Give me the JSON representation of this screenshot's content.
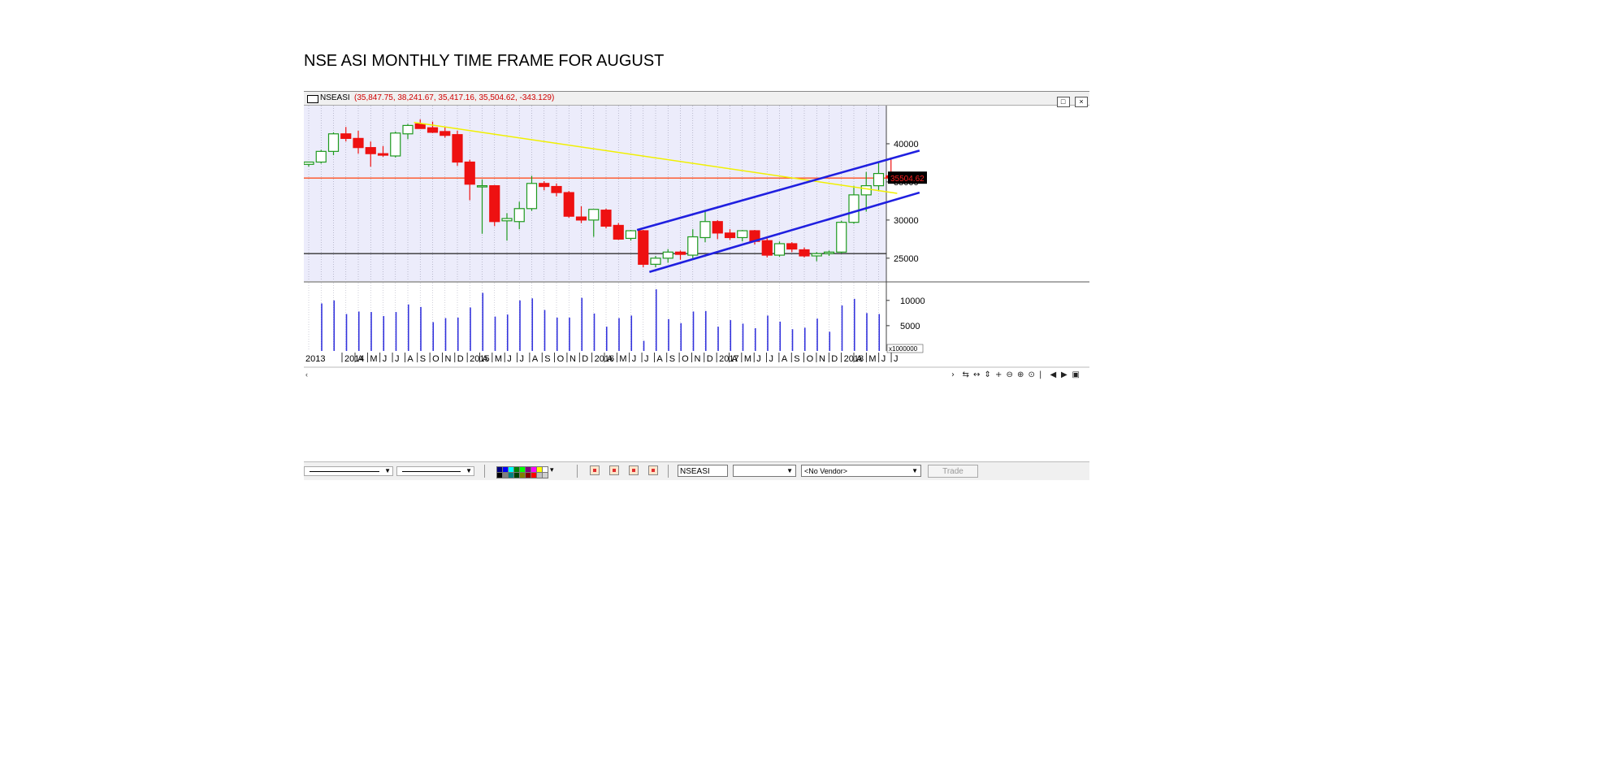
{
  "page": {
    "title": "NSE ASI MONTHLY TIME FRAME FOR AUGUST"
  },
  "window": {
    "symbol": "NSEASI",
    "ohlc": "(35,847.75, 38,241.67, 35,417.16, 35,504.62, -343.129)",
    "buttons": [
      "□",
      "×"
    ]
  },
  "toolbar": {
    "symbol_value": "NSEASI",
    "dropdown_empty": "",
    "vendor": "<No Vendor>",
    "trade_label": "Trade"
  },
  "colors": {
    "bull": "#1f9a1f",
    "bear": "#ee1111",
    "plot_bg": "#ececfb",
    "channel": "#1f1fe0",
    "trendline": "#f0f000",
    "resistance": "#ff5020",
    "support": "#333333",
    "volume": "#3333dd"
  },
  "chart_data": {
    "type": "candlestick",
    "price_ticks": [
      40000,
      35000,
      30000,
      25000
    ],
    "volume_ticks": [
      10000,
      5000
    ],
    "volume_scale_label": "x1000000",
    "last_price_label": "35504.62",
    "ylim": [
      22000,
      45000
    ],
    "volume_ylim": [
      0,
      13500
    ],
    "x_labels": [
      "2013",
      "2014",
      "A",
      "M",
      "J",
      "J",
      "A",
      "S",
      "O",
      "N",
      "D",
      "2015",
      "A",
      "M",
      "J",
      "J",
      "A",
      "S",
      "O",
      "N",
      "D",
      "2016",
      "A",
      "M",
      "J",
      "J",
      "A",
      "S",
      "O",
      "N",
      "D",
      "2017",
      "A",
      "M",
      "J",
      "J",
      "A",
      "S",
      "O",
      "N",
      "D",
      "2018",
      "A",
      "M",
      "J",
      "J"
    ],
    "candles": [
      {
        "o": 37300,
        "h": 37600,
        "l": 37000,
        "c": 37600
      },
      {
        "o": 37600,
        "h": 39200,
        "l": 37400,
        "c": 39000
      },
      {
        "o": 39000,
        "h": 41500,
        "l": 38500,
        "c": 41300
      },
      {
        "o": 41300,
        "h": 42200,
        "l": 40300,
        "c": 40700
      },
      {
        "o": 40700,
        "h": 41700,
        "l": 38700,
        "c": 39500
      },
      {
        "o": 39500,
        "h": 40300,
        "l": 37000,
        "c": 38700
      },
      {
        "o": 38700,
        "h": 39700,
        "l": 38300,
        "c": 38500
      },
      {
        "o": 38400,
        "h": 41600,
        "l": 38200,
        "c": 41400
      },
      {
        "o": 41300,
        "h": 42600,
        "l": 40600,
        "c": 42400
      },
      {
        "o": 42600,
        "h": 43200,
        "l": 42000,
        "c": 42000
      },
      {
        "o": 42100,
        "h": 42900,
        "l": 41400,
        "c": 41500
      },
      {
        "o": 41600,
        "h": 42200,
        "l": 40800,
        "c": 41100
      },
      {
        "o": 41200,
        "h": 41700,
        "l": 37100,
        "c": 37600
      },
      {
        "o": 37600,
        "h": 37900,
        "l": 32600,
        "c": 34700
      },
      {
        "o": 34500,
        "h": 35300,
        "l": 28200,
        "c": 34500
      },
      {
        "o": 34500,
        "h": 34600,
        "l": 29200,
        "c": 29800
      },
      {
        "o": 29900,
        "h": 30900,
        "l": 27300,
        "c": 30200
      },
      {
        "o": 29800,
        "h": 32400,
        "l": 28800,
        "c": 31500
      },
      {
        "o": 31500,
        "h": 35800,
        "l": 31200,
        "c": 34800
      },
      {
        "o": 34800,
        "h": 35100,
        "l": 33900,
        "c": 34400
      },
      {
        "o": 34400,
        "h": 34800,
        "l": 33100,
        "c": 33600
      },
      {
        "o": 33600,
        "h": 33800,
        "l": 30300,
        "c": 30500
      },
      {
        "o": 30400,
        "h": 31800,
        "l": 29600,
        "c": 30000
      },
      {
        "o": 30000,
        "h": 31400,
        "l": 27800,
        "c": 31400
      },
      {
        "o": 31300,
        "h": 31500,
        "l": 28900,
        "c": 29200
      },
      {
        "o": 29300,
        "h": 29600,
        "l": 27400,
        "c": 27500
      },
      {
        "o": 27600,
        "h": 28700,
        "l": 27300,
        "c": 28600
      },
      {
        "o": 28600,
        "h": 28700,
        "l": 23800,
        "c": 24200
      },
      {
        "o": 24200,
        "h": 25300,
        "l": 23800,
        "c": 25000
      },
      {
        "o": 25000,
        "h": 26200,
        "l": 24400,
        "c": 25800
      },
      {
        "o": 25800,
        "h": 26000,
        "l": 24800,
        "c": 25500
      },
      {
        "o": 25400,
        "h": 28800,
        "l": 25000,
        "c": 27800
      },
      {
        "o": 27700,
        "h": 31200,
        "l": 27100,
        "c": 29800
      },
      {
        "o": 29800,
        "h": 30000,
        "l": 27500,
        "c": 28300
      },
      {
        "o": 28300,
        "h": 28800,
        "l": 27400,
        "c": 27700
      },
      {
        "o": 27700,
        "h": 28700,
        "l": 27200,
        "c": 28600
      },
      {
        "o": 28600,
        "h": 28700,
        "l": 26800,
        "c": 27200
      },
      {
        "o": 27300,
        "h": 27600,
        "l": 25100,
        "c": 25400
      },
      {
        "o": 25400,
        "h": 27200,
        "l": 25200,
        "c": 26900
      },
      {
        "o": 26900,
        "h": 27100,
        "l": 25800,
        "c": 26200
      },
      {
        "o": 26100,
        "h": 26400,
        "l": 25100,
        "c": 25300
      },
      {
        "o": 25300,
        "h": 25800,
        "l": 24600,
        "c": 25600
      },
      {
        "o": 25600,
        "h": 26000,
        "l": 25300,
        "c": 25800
      },
      {
        "o": 25800,
        "h": 29900,
        "l": 25600,
        "c": 29700
      },
      {
        "o": 29700,
        "h": 34500,
        "l": 29500,
        "c": 33300
      },
      {
        "o": 33300,
        "h": 36300,
        "l": 31100,
        "c": 34500
      },
      {
        "o": 34500,
        "h": 37500,
        "l": 33800,
        "c": 36100
      },
      {
        "o": 35800,
        "h": 38200,
        "l": 35400,
        "c": 35500
      }
    ],
    "volumes": [
      9400,
      10000,
      7300,
      7800,
      7700,
      6900,
      7700,
      9200,
      8700,
      5700,
      6500,
      6600,
      8600,
      11500,
      6800,
      7200,
      10000,
      10400,
      8100,
      6600,
      6600,
      10500,
      7400,
      4800,
      6500,
      7000,
      2000,
      12200,
      6300,
      5500,
      7800,
      7900,
      4800,
      6100,
      5400,
      4500,
      7000,
      5800,
      4300,
      4600,
      6400,
      3800,
      9000,
      10300,
      7500,
      7300
    ],
    "lines": [
      {
        "name": "resistance",
        "y": 35504
      },
      {
        "name": "support",
        "y": 25600
      }
    ],
    "trendlines": [
      {
        "kind": "trendline",
        "from": {
          "i": 8.5,
          "v": 42800
        },
        "to": {
          "i": 47.5,
          "v": 33500
        }
      },
      {
        "kind": "channel",
        "from": {
          "i": 26.5,
          "v": 28700
        },
        "to": {
          "i": 49.3,
          "v": 39100
        }
      },
      {
        "kind": "channel",
        "from": {
          "i": 27.5,
          "v": 23200
        },
        "to": {
          "i": 49.3,
          "v": 33600
        }
      }
    ]
  }
}
